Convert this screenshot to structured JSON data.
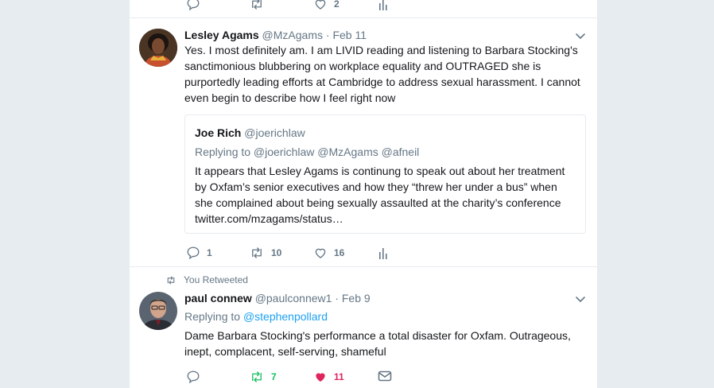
{
  "top_actions": {
    "like_count": "2"
  },
  "tweet1": {
    "name": "Lesley Agams",
    "handle": "@MzAgams",
    "date": "Feb 11",
    "text_lines": [
      "Yes. I most definitely am. I am LIVID reading and listening to Barbara Stocking's",
      "sanctimonious blubbering on workplace equality and OUTRAGED she is",
      "purportedly leading efforts at Cambridge to address sexual harassment. I cannot",
      "even begin to describe how I feel right now"
    ],
    "quote": {
      "name": "Joe Rich",
      "handle": "@joerichlaw",
      "replying_to": "Replying to @joerichlaw @MzAgams @afneil",
      "text_lines": [
        "It appears that Lesley Agams is continung to speak out about her treatment",
        "by Oxfam’s senior executives and how they “threw her under a bus” when",
        "she complained about being sexually assaulted at the charity’s conference",
        "twitter.com/mzagams/status…"
      ]
    },
    "reply_count": "1",
    "retweet_count": "10",
    "like_count": "16"
  },
  "tweet2": {
    "context": "You Retweeted",
    "name": "paul connew",
    "handle": "@paulconnew1",
    "date": "Feb 9",
    "replying_prefix": "Replying to",
    "replying_handle": "@stephenpollard",
    "text_lines": [
      "Dame Barbara Stocking's performance a total disaster for Oxfam. Outrageous,",
      "inept, complacent, self-serving, shameful"
    ],
    "retweet_count": "7",
    "like_count": "11"
  },
  "colors": {
    "retweet_active": "#17bf63",
    "like_active": "#e0245e",
    "link": "#1da1f2",
    "muted": "#657786"
  }
}
